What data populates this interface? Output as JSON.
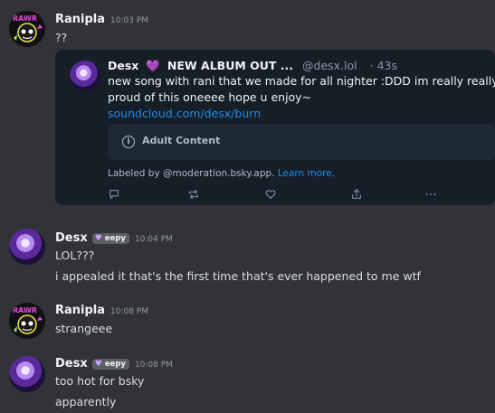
{
  "messages": [
    {
      "author": "Ranipla",
      "time": "10:03 PM",
      "lines": [
        "??"
      ],
      "embed": {
        "author_name": "Desx",
        "title_rest": "NEW ALBUM OUT ...",
        "handle": "@desx.lol",
        "age": "· 43s",
        "text_lines": [
          "new song with rani that we made for all nighter :DDD im really really",
          "proud of this oneeee hope u enjoy~"
        ],
        "link": "soundcloud.com/desx/burn",
        "warning": "Adult Content",
        "labeled_prefix": "Labeled by @moderation.bsky.app.",
        "learn_more": "Learn more."
      }
    },
    {
      "author": "Desx",
      "badge": "eepy",
      "time": "10:04 PM",
      "lines": [
        "LOL???",
        "i appealed it that's the first time that's ever happened to me wtf"
      ]
    },
    {
      "author": "Ranipla",
      "time": "10:08 PM",
      "lines": [
        "strangeee"
      ]
    },
    {
      "author": "Desx",
      "badge": "eepy",
      "time": "10:08 PM",
      "lines": [
        "too hot for bsky",
        "apparently"
      ]
    }
  ],
  "colors": {
    "background": "#313338",
    "embed_bg": "#161e27",
    "link": "#1d8cf0",
    "heart": "#a56cf0"
  },
  "icons": [
    "reply-icon",
    "repost-icon",
    "like-icon",
    "share-icon",
    "more-icon",
    "info-icon",
    "heart-icon"
  ]
}
